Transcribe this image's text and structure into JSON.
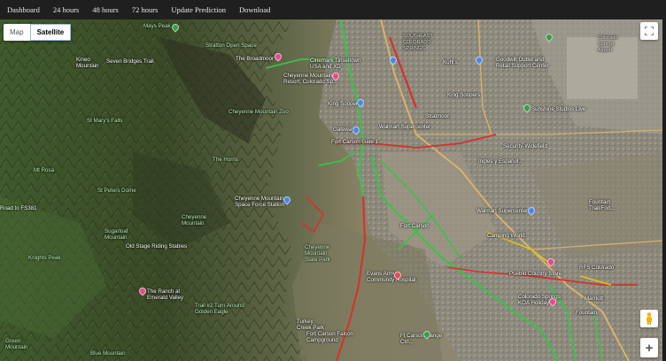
{
  "nav": {
    "items": [
      "Dashboard",
      "24 hours",
      "48 hours",
      "72 hours",
      "Update Prediction",
      "Download"
    ]
  },
  "map": {
    "type_control": {
      "map_label": "Map",
      "satellite_label": "Satellite",
      "selected": "Satellite"
    },
    "zoom_in_label": "+",
    "colors": {
      "traffic_green": "#39c24a",
      "traffic_red": "#d8302a",
      "traffic_yellow": "#e3c21b",
      "highway": "#d8b26b"
    },
    "labels": {
      "mays_peak": "Mays Peak",
      "seven_bridges": "Seven Bridges Trail",
      "kineo_mountain": "Kineo\nMountain",
      "stratton_open_space": "Stratton Open Space",
      "the_broadmoor": "The Broadmoor",
      "cinemark": "Cinemark Tinseltown\nUSA and XD",
      "southeast_colorado": "SOUTHEAST\nCOLORADO\nSPRINGS",
      "kohls": "Kohl's",
      "kings_soopers_top": "King Soopers",
      "goodwill": "Goodwill Outlet and\nRetail Support Center",
      "colorado_springs_airport": "Colorado\nSprings\nAirport",
      "cheyenne_resort": "Cheyenne Mountain\nResort, Colorado Sp...",
      "kings_soopers": "King Soopers",
      "stratmoor": "Stratmoor",
      "walmart_super_1": "Walmart Supercenter",
      "sunshine_studios": "Sunshine Studios Live",
      "st_marys_falls": "St Mary's Falls",
      "cheyenne_zoo": "Cheyenne Mountain Zoo",
      "gateway": "Gateway",
      "fort_carson_gate": "Fort Carson Gate 1",
      "security_widefield": "Security-Widefield",
      "mt_rosa": "Mt Rosa",
      "the_horns": "The Horns",
      "ingles_y_espanol": "Ingles y Espanol...",
      "st_peters_dome": "St Peters Dome",
      "cheyenne_space_force": "Cheyenne Mountain\nSpace Force Station",
      "cheyenne_mountain": "Cheyenne\nMountain",
      "sugarloaf": "Sugarloaf\nMountain",
      "walmart_super_2": "Walmart Supercenter",
      "fountain_fort": "Fountain\nTrail/Fort...",
      "fs381": "Road to FS381",
      "old_stage": "Old Stage Riding Stables",
      "fort_carson": "Fort Carson",
      "camping_world": "Camping World",
      "knights_peak": "Knights Peak",
      "cheyenne_state_park": "Cheyenne\nMountain\nState Park",
      "evans_army": "Evans Army\nCommunity Hospital",
      "rfs_colorado": "RFS Colorado",
      "pueblo_country": "Pueblo Country Store",
      "ranch_emerald": "The Ranch at\nEmerald Valley",
      "trail42": "Trail #2 Turn Around\nGolden Eagle",
      "cs_koa": "Colorado Springs\nKOA Holiday",
      "fountain": "Fountain",
      "turkey_creek": "Turkey\nCreek Park",
      "fort_carson_falcon": "Fort Carson Falcon\nCampground",
      "green_mountain": "Green\nMountain",
      "blue_mountain": "Blue Mountain",
      "ft_carson_rts": "Ft Carson Range\nCtrl...",
      "marriott": "Marriott"
    }
  }
}
